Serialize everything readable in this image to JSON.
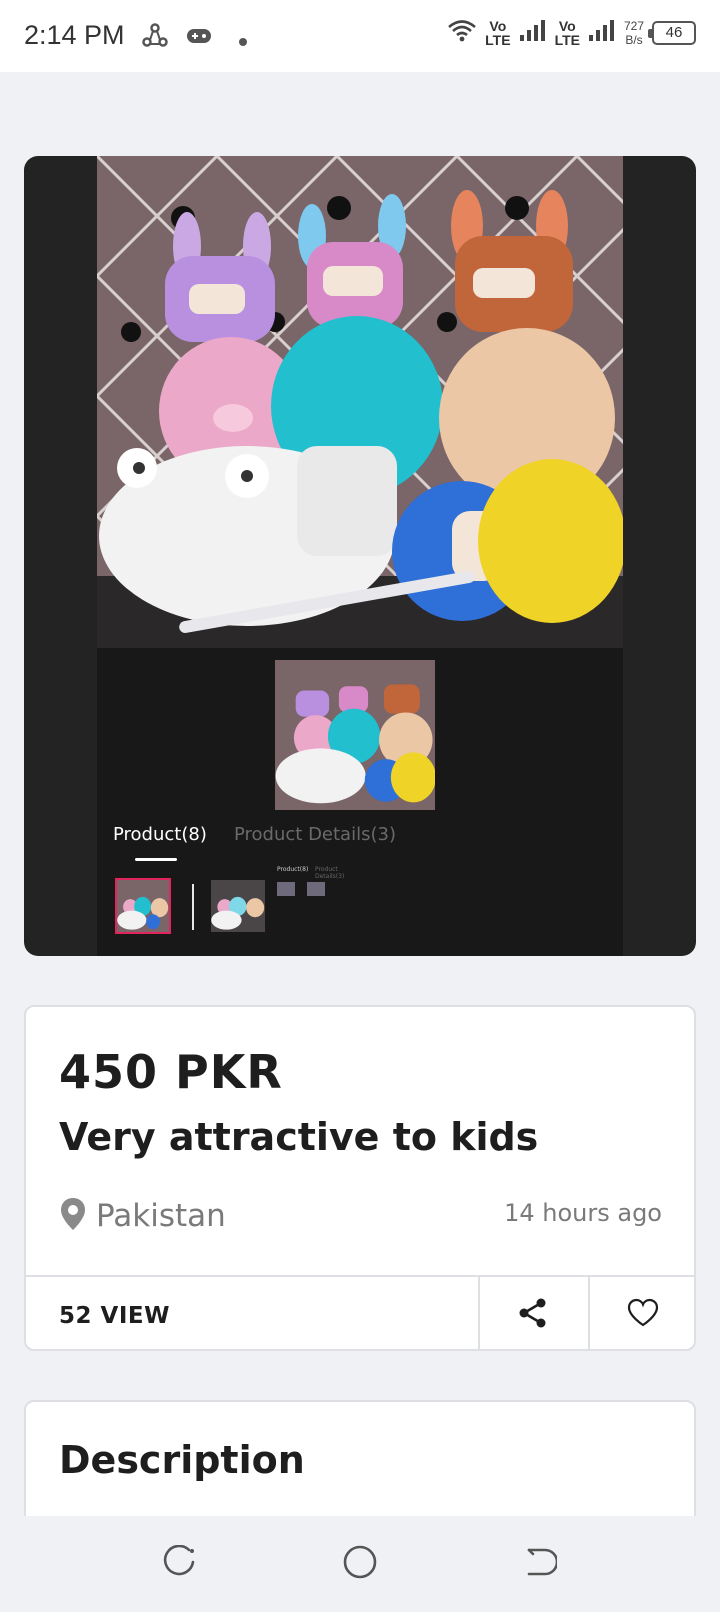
{
  "status_bar": {
    "time": "2:14 PM",
    "network_speed_value": "727",
    "network_speed_unit": "B/s",
    "battery": "46",
    "lte_label_top": "Vo",
    "lte_label_bottom": "LTE"
  },
  "gallery": {
    "tabs": [
      {
        "label": "Product(8)",
        "active": true
      },
      {
        "label": "Product Details(3)",
        "active": false
      }
    ],
    "thumbnail_count": 2,
    "mini_tab_labels": [
      "Product(8)",
      "Product Details(3)"
    ]
  },
  "listing": {
    "price": "450 PKR",
    "title": "Very attractive to kids",
    "location": "Pakistan",
    "posted": "14 hours ago",
    "views": "52 VIEW"
  },
  "description": {
    "heading": "Description"
  },
  "icons": {
    "location": "map-pin-icon",
    "share": "share-icon",
    "favorite": "heart-icon",
    "nav_recents": "recents-icon",
    "nav_home": "home-icon",
    "nav_back": "back-icon"
  },
  "colors": {
    "accent_selected": "#e0245e",
    "background": "#f0f1f5",
    "card": "#ffffff",
    "media_bg": "#232323"
  }
}
